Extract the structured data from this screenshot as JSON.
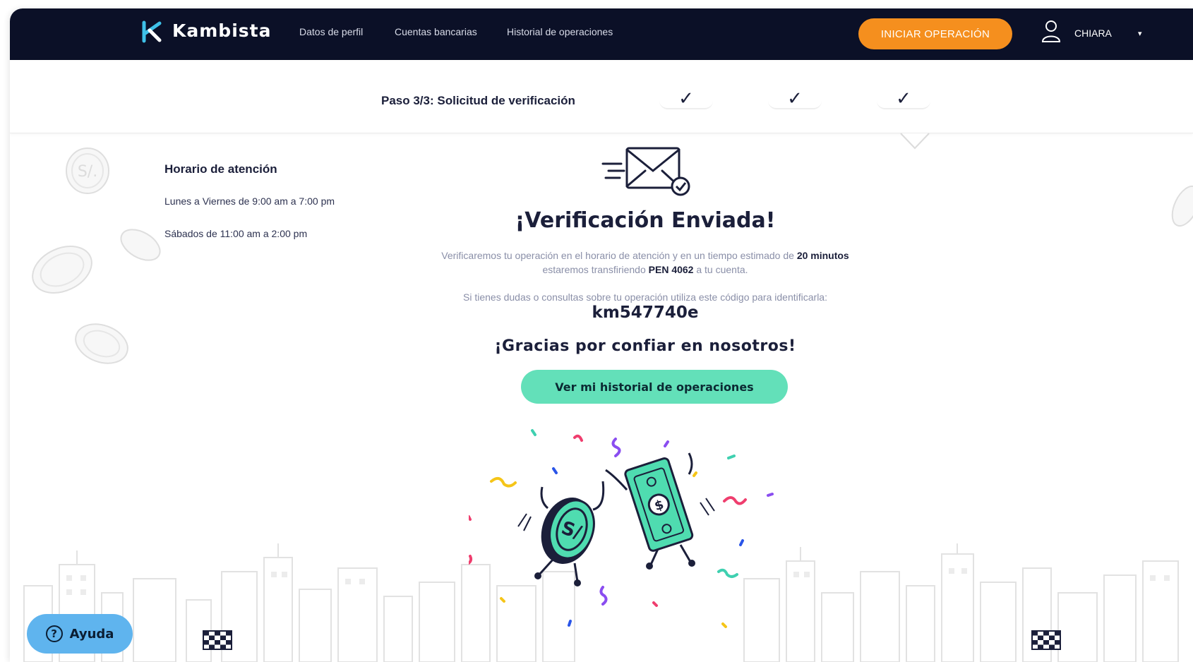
{
  "navbar": {
    "brand": "Kambista",
    "links": [
      "Datos de perfil",
      "Cuentas bancarias",
      "Historial de operaciones"
    ],
    "cta_label": "INICIAR OPERACIÓN",
    "user_name": "CHIARA",
    "user_caret": "▾"
  },
  "stepper": {
    "title": "Paso 3/3: Solicitud de verificación",
    "check_glyph": "✓"
  },
  "hours": {
    "title": "Horario de atención",
    "lines": [
      "Lunes a Viernes de 9:00 am a 7:00 pm",
      "Sábados de 11:00 am a 2:00 pm"
    ]
  },
  "confirmation": {
    "headline": "¡Verificación Enviada!",
    "message_part1": "Verificaremos tu operación en el horario de atención y en un tiempo estimado de",
    "time_estimate": "20 minutos",
    "message_part2": "estaremos transfiriendo",
    "amount": "PEN 4062",
    "message_part3": "a tu cuenta.",
    "code_intro": "Si tienes dudas o consultas sobre tu operación utiliza este código para identificarla:",
    "operation_code": "km547740e",
    "thanks": "¡Gracias por confiar en nosotros!",
    "history_button": "Ver mi historial de operaciones"
  },
  "help": {
    "label": "Ayuda",
    "icon_glyph": "?"
  },
  "colors": {
    "navbar_bg": "#0b1027",
    "cta": "#f58f1e",
    "accent_green": "#63e0b9",
    "help_blue": "#5fb4ee",
    "text_dark": "#1b1f3a"
  },
  "icons": [
    "kambista-logo-icon",
    "user-icon",
    "envelope-sent-icon",
    "check-icon",
    "help-icon",
    "finish-flag-icon",
    "coin-icon"
  ]
}
